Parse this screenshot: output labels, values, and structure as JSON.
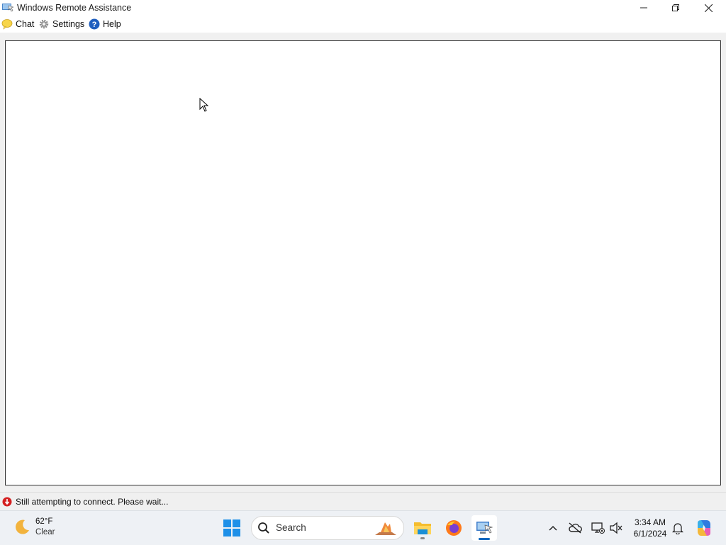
{
  "window": {
    "title": "Windows Remote Assistance"
  },
  "toolbar": {
    "chat_label": "Chat",
    "settings_label": "Settings",
    "help_label": "Help"
  },
  "status": {
    "text": "Still attempting to connect.  Please wait..."
  },
  "taskbar": {
    "weather_temp": "62°F",
    "weather_condition": "Clear",
    "search_placeholder": "Search",
    "time": "3:34 AM",
    "date": "6/1/2024",
    "apps": [
      "file-explorer-icon",
      "firefox-icon",
      "remote-assistance-icon"
    ]
  },
  "colors": {
    "accent": "#0067c0",
    "status_error": "#d42020",
    "help_blue": "#1f5fbf"
  }
}
